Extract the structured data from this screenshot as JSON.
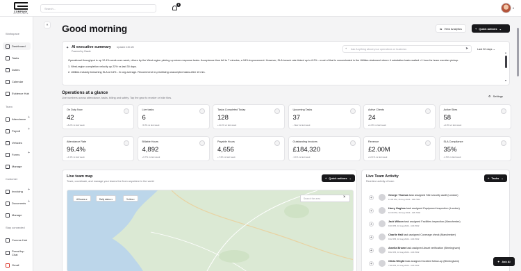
{
  "header": {
    "logo_name": "COMPANY",
    "logo_sub": "INTELLIGENCE",
    "search_placeholder": "Search...",
    "notification_count": "6"
  },
  "sidebar": {
    "sections": [
      {
        "label": "Workspace",
        "items": [
          {
            "label": "Dashboard",
            "active": true
          },
          {
            "label": "Tasks"
          },
          {
            "label": "Duties"
          },
          {
            "label": "Calendar"
          },
          {
            "label": "Evidence Hub"
          }
        ]
      },
      {
        "label": "Team",
        "items": [
          {
            "label": "Attendance",
            "plus": true
          },
          {
            "label": "Payroll",
            "plus": true
          },
          {
            "label": "Vehicles"
          },
          {
            "label": "Forms",
            "plus": true
          },
          {
            "label": "Manage"
          }
        ]
      },
      {
        "label": "Customer",
        "items": [
          {
            "label": "Invoicing",
            "plus": true
          },
          {
            "label": "Documents",
            "plus": true
          },
          {
            "label": "Manage"
          }
        ]
      },
      {
        "label": "Stay connected",
        "items": [
          {
            "label": "Comms Hub"
          },
          {
            "label": "PressHop Chat"
          },
          {
            "label": "Gmail"
          }
        ]
      }
    ]
  },
  "page": {
    "greeting": "Good morning",
    "view_analytics": "View Analytics",
    "quick_actions": "Quick actions"
  },
  "exec": {
    "title": "AI executive summary",
    "updated": "Updated 6:30 AM",
    "powered": "Powered by Claude",
    "ask_placeholder": "Ask Anything about your operations or business",
    "range": "Last 30 days",
    "paragraph": "Operational throughput is up 12.4% week-over-week, driven by the West region picking up storm-response tasks. Acceptance time fell to 7 minutes, a 18% improvement. However, SLA breach rate ticked up to 6.2% - most of that is concentrated in the Utilities statement where 4 substation tasks waited >1 hour for team member pickup.",
    "bullets": [
      "1.  West-region completion velocity up 22% vs last 30 days.",
      "2.  Utilities industry breaching SLA at 14% - 2x org average. Recommend re-prioritizing unaccepted tasks after 10 min."
    ]
  },
  "ops": {
    "title": "Operations at a glance",
    "subtitle": "Live numbers across attendance, tasks, billing and safety. Tap the gear to reorder or hide tiles.",
    "settings": "Settings",
    "kpis": [
      {
        "label": "On Duty Now",
        "value": "42",
        "delta": "+6.2%  vs last week"
      },
      {
        "label": "Live tasks",
        "value": "6",
        "delta": "-5.0%  vs last week"
      },
      {
        "label": "Tasks Completed Today",
        "value": "128",
        "delta": "+11.4%  vs last week"
      },
      {
        "label": "Upcoming Tasks",
        "value": "37",
        "delta": "- New  vs last week"
      },
      {
        "label": "Active Clients",
        "value": "24",
        "delta": "+4.0%  vs last week"
      },
      {
        "label": "Active Sites",
        "value": "58",
        "delta": "+4.0%  vs last week"
      },
      {
        "label": "Attendance Rate",
        "value": "96.4%",
        "delta": "+1.3%  vs last week"
      },
      {
        "label": "Billable Hours",
        "value": "4,892",
        "delta": "+6.7%  vs last week"
      },
      {
        "label": "Payable Hours",
        "value": "4,656",
        "delta": "+7.4%  vs last week"
      },
      {
        "label": "Outstanding Invoices",
        "value": "£184,320",
        "delta": "-3.1%  vs last week"
      },
      {
        "label": "Revenue",
        "value": "£2.00M",
        "delta": "+12.1%  vs last week"
      },
      {
        "label": "SLA Compliance",
        "value": "35%",
        "delta": "-4.6%  vs last week"
      }
    ]
  },
  "map": {
    "title": "Live team map",
    "subtitle": "Track, coordinate, and manage your teams live from anywhere in the world",
    "quick_actions": "Quick actions",
    "chips": [
      "All teams",
      "Daily status",
      "3 sites"
    ],
    "search_placeholder": "Search the area"
  },
  "activity": {
    "title": "Live Team Activity",
    "subtitle": "Real-time activity of team",
    "tasks_button": "Tasks",
    "rows": [
      {
        "name": "George Thomas",
        "verb": " task assigned ",
        "task": "Site security audit (London)",
        "time": "11:03 PM, 16 Aug 2024 - GB-7002"
      },
      {
        "name": "Harry Hughes",
        "verb": " task assigned ",
        "task": "Equipment inspection (London)",
        "time": "10:18 PM, 16 Aug 2024 - GB-7002"
      },
      {
        "name": "Jack Wilson",
        "verb": " task assigned ",
        "task": "Facilities inspection (Manchester)",
        "time": "9:40 PM, 16 Aug 2024 - GB-7002"
      },
      {
        "name": "Charlie Hall",
        "verb": " task assigned ",
        "task": "Coverage check (Manchester)",
        "time": "9:12 PM, 16 Aug 2024 - GB-7002"
      },
      {
        "name": "Amelia Brown",
        "verb": " task assigned ",
        "task": "Asset verification (Birmingham)",
        "time": "8:02 PM, 16 Aug 2024 - GB-7002"
      },
      {
        "name": "Olivia Wright",
        "verb": " task assigned ",
        "task": "Incident follow-up (Birmingham)",
        "time": "7:38 PM, 16 Aug 2024 - GB-7002"
      }
    ]
  },
  "ask_ai": "Ask AI",
  "colors": {
    "accent": "#18181b",
    "background": "#f4f4f5",
    "map_land": "#dbe9d4",
    "map_water": "#bcd6ea"
  }
}
